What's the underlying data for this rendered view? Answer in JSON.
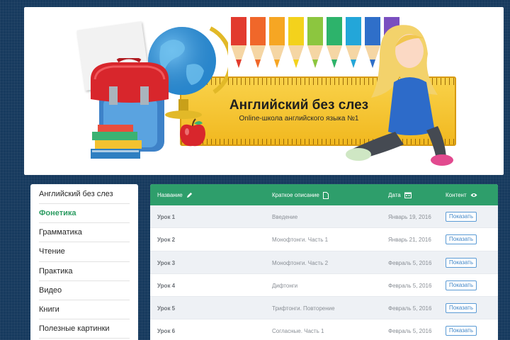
{
  "banner": {
    "title": "Английский без слез",
    "subtitle": "Online-школа английского языка №1"
  },
  "sidebar": {
    "items": [
      {
        "label": "Английский без слез",
        "active": false
      },
      {
        "label": "Фонетика",
        "active": true
      },
      {
        "label": "Грамматика",
        "active": false
      },
      {
        "label": "Чтение",
        "active": false
      },
      {
        "label": "Практика",
        "active": false
      },
      {
        "label": "Видео",
        "active": false
      },
      {
        "label": "Книги",
        "active": false
      },
      {
        "label": "Полезные картинки",
        "active": false
      }
    ]
  },
  "table": {
    "headers": {
      "name": "Название",
      "name_icon": "pencil-icon",
      "desc": "Краткое описание",
      "desc_icon": "document-icon",
      "date": "Дата",
      "date_icon": "calendar-icon",
      "content": "Контент",
      "content_icon": "eye-icon"
    },
    "show_label": "Показать",
    "rows": [
      {
        "lesson": "Урок 1",
        "desc": "Введение",
        "date": "Январь 19, 2016"
      },
      {
        "lesson": "Урок 2",
        "desc": "Монофтонги. Часть 1",
        "date": "Январь 21, 2016"
      },
      {
        "lesson": "Урок 3",
        "desc": "Монофтонги. Часть 2",
        "date": "Февраль 5, 2016"
      },
      {
        "lesson": "Урок 4",
        "desc": "Дифтонги",
        "date": "Февраль 5, 2016"
      },
      {
        "lesson": "Урок 5",
        "desc": "Трифтонги. Повторение",
        "date": "Февраль 5, 2016"
      },
      {
        "lesson": "Урок 6",
        "desc": "Согласные. Часть 1",
        "date": "Февраль 5, 2016"
      }
    ]
  },
  "colors": {
    "page_bg": "#173a5e",
    "header_green": "#2e9e6b",
    "active_nav": "#2c9c62",
    "button_blue": "#3f85c7",
    "ruler_yellow": "#f1b81f"
  },
  "decor_icons": [
    "school-backpack-icon",
    "globe-icon",
    "apple-icon",
    "books-icon",
    "colored-pencils-icon",
    "ruler-icon",
    "schoolgirl-illustration"
  ]
}
